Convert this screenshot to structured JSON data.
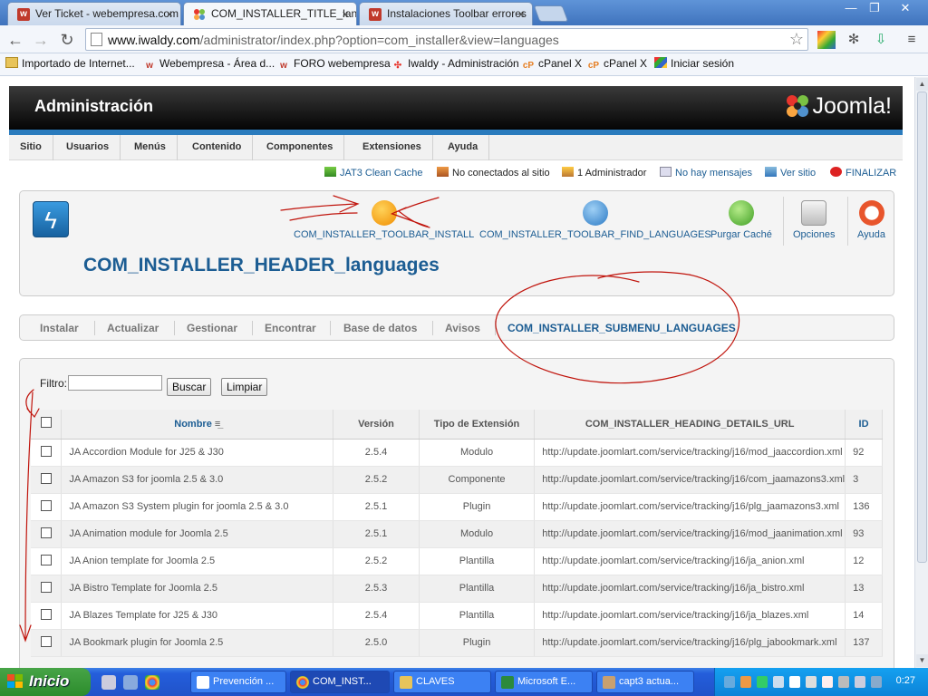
{
  "browser": {
    "tabs": [
      {
        "label": "Ver Ticket - webempresa.com",
        "icon": "webempresa-favicon"
      },
      {
        "label": "COM_INSTALLER_TITLE_languages",
        "icon": "joomla-favicon"
      },
      {
        "label": "Instalaciones Toolbar errores",
        "icon": "webempresa-favicon"
      }
    ],
    "url_host": "www.iwaldy.com",
    "url_path": "/administrator/index.php?option=com_installer&view=languages",
    "bookmarks": [
      {
        "label": "Importado de Internet...",
        "icon": "folder-icon"
      },
      {
        "label": "Webempresa - Área d...",
        "icon": "webempresa-icon"
      },
      {
        "label": "FORO webempresa",
        "icon": "webempresa-icon"
      },
      {
        "label": "Iwaldy - Administración",
        "icon": "joomla-icon"
      },
      {
        "label": "cPanel X",
        "icon": "cpanel-icon"
      },
      {
        "label": "cPanel X",
        "icon": "cpanel-icon"
      },
      {
        "label": "Iniciar sesión",
        "icon": "windows-live-icon"
      }
    ]
  },
  "admin": {
    "header_title": "Administración",
    "logo_text": "Joomla!",
    "menu": [
      "Sitio",
      "Usuarios",
      "Menús",
      "Contenido",
      "Componentes",
      "Extensiones",
      "Ayuda"
    ],
    "status": {
      "cache": "JAT3 Clean Cache",
      "not_connected": "No conectados al sitio",
      "admins": "1 Administrador",
      "messages": "No hay mensajes",
      "view_site": "Ver sitio",
      "logout": "FINALIZAR"
    },
    "toolbar": {
      "install": "COM_INSTALLER_TOOLBAR_INSTALL",
      "find_languages": "COM_INSTALLER_TOOLBAR_FIND_LANGUAGES",
      "purge_cache": "Purgar Caché",
      "options": "Opciones",
      "help": "Ayuda"
    },
    "page_title": "COM_INSTALLER_HEADER_languages",
    "submenu": [
      "Instalar",
      "Actualizar",
      "Gestionar",
      "Encontrar",
      "Base de datos",
      "Avisos",
      "COM_INSTALLER_SUBMENU_LANGUAGES"
    ],
    "filter": {
      "label": "Filtro:",
      "value": "",
      "search_button": "Buscar",
      "clear_button": "Limpiar"
    },
    "table": {
      "headers": [
        "Nombre",
        "Versión",
        "Tipo de Extensión",
        "COM_INSTALLER_HEADING_DETAILS_URL",
        "ID"
      ],
      "rows": [
        [
          "JA Accordion Module for J25 & J30",
          "2.5.4",
          "Modulo",
          "http://update.joomlart.com/service/tracking/j16/mod_jaaccordion.xml",
          "92"
        ],
        [
          "JA Amazon S3 for joomla 2.5 & 3.0",
          "2.5.2",
          "Componente",
          "http://update.joomlart.com/service/tracking/j16/com_jaamazons3.xml",
          "3"
        ],
        [
          "JA Amazon S3 System plugin for joomla 2.5 & 3.0",
          "2.5.1",
          "Plugin",
          "http://update.joomlart.com/service/tracking/j16/plg_jaamazons3.xml",
          "136"
        ],
        [
          "JA Animation module for Joomla 2.5",
          "2.5.1",
          "Modulo",
          "http://update.joomlart.com/service/tracking/j16/mod_jaanimation.xml",
          "93"
        ],
        [
          "JA Anion template for Joomla 2.5",
          "2.5.2",
          "Plantilla",
          "http://update.joomlart.com/service/tracking/j16/ja_anion.xml",
          "12"
        ],
        [
          "JA Bistro Template for Joomla 2.5",
          "2.5.3",
          "Plantilla",
          "http://update.joomlart.com/service/tracking/j16/ja_bistro.xml",
          "13"
        ],
        [
          "JA Blazes Template for J25 & J30",
          "2.5.4",
          "Plantilla",
          "http://update.joomlart.com/service/tracking/j16/ja_blazes.xml",
          "14"
        ],
        [
          "JA Bookmark plugin for Joomla 2.5",
          "2.5.0",
          "Plugin",
          "http://update.joomlart.com/service/tracking/j16/plg_jabookmark.xml",
          "137"
        ]
      ]
    }
  },
  "taskbar": {
    "start_label": "Inicio",
    "items": [
      {
        "label": "Prevención ...",
        "active": false
      },
      {
        "label": "COM_INST...",
        "active": true
      },
      {
        "label": "CLAVES",
        "active": false
      },
      {
        "label": "Microsoft E...",
        "active": false
      },
      {
        "label": "capt3 actua...",
        "active": false
      }
    ],
    "clock": "0:27"
  },
  "colors": {
    "joomla_blue": "#1c5d93",
    "annotation_red": "#c0140c"
  }
}
